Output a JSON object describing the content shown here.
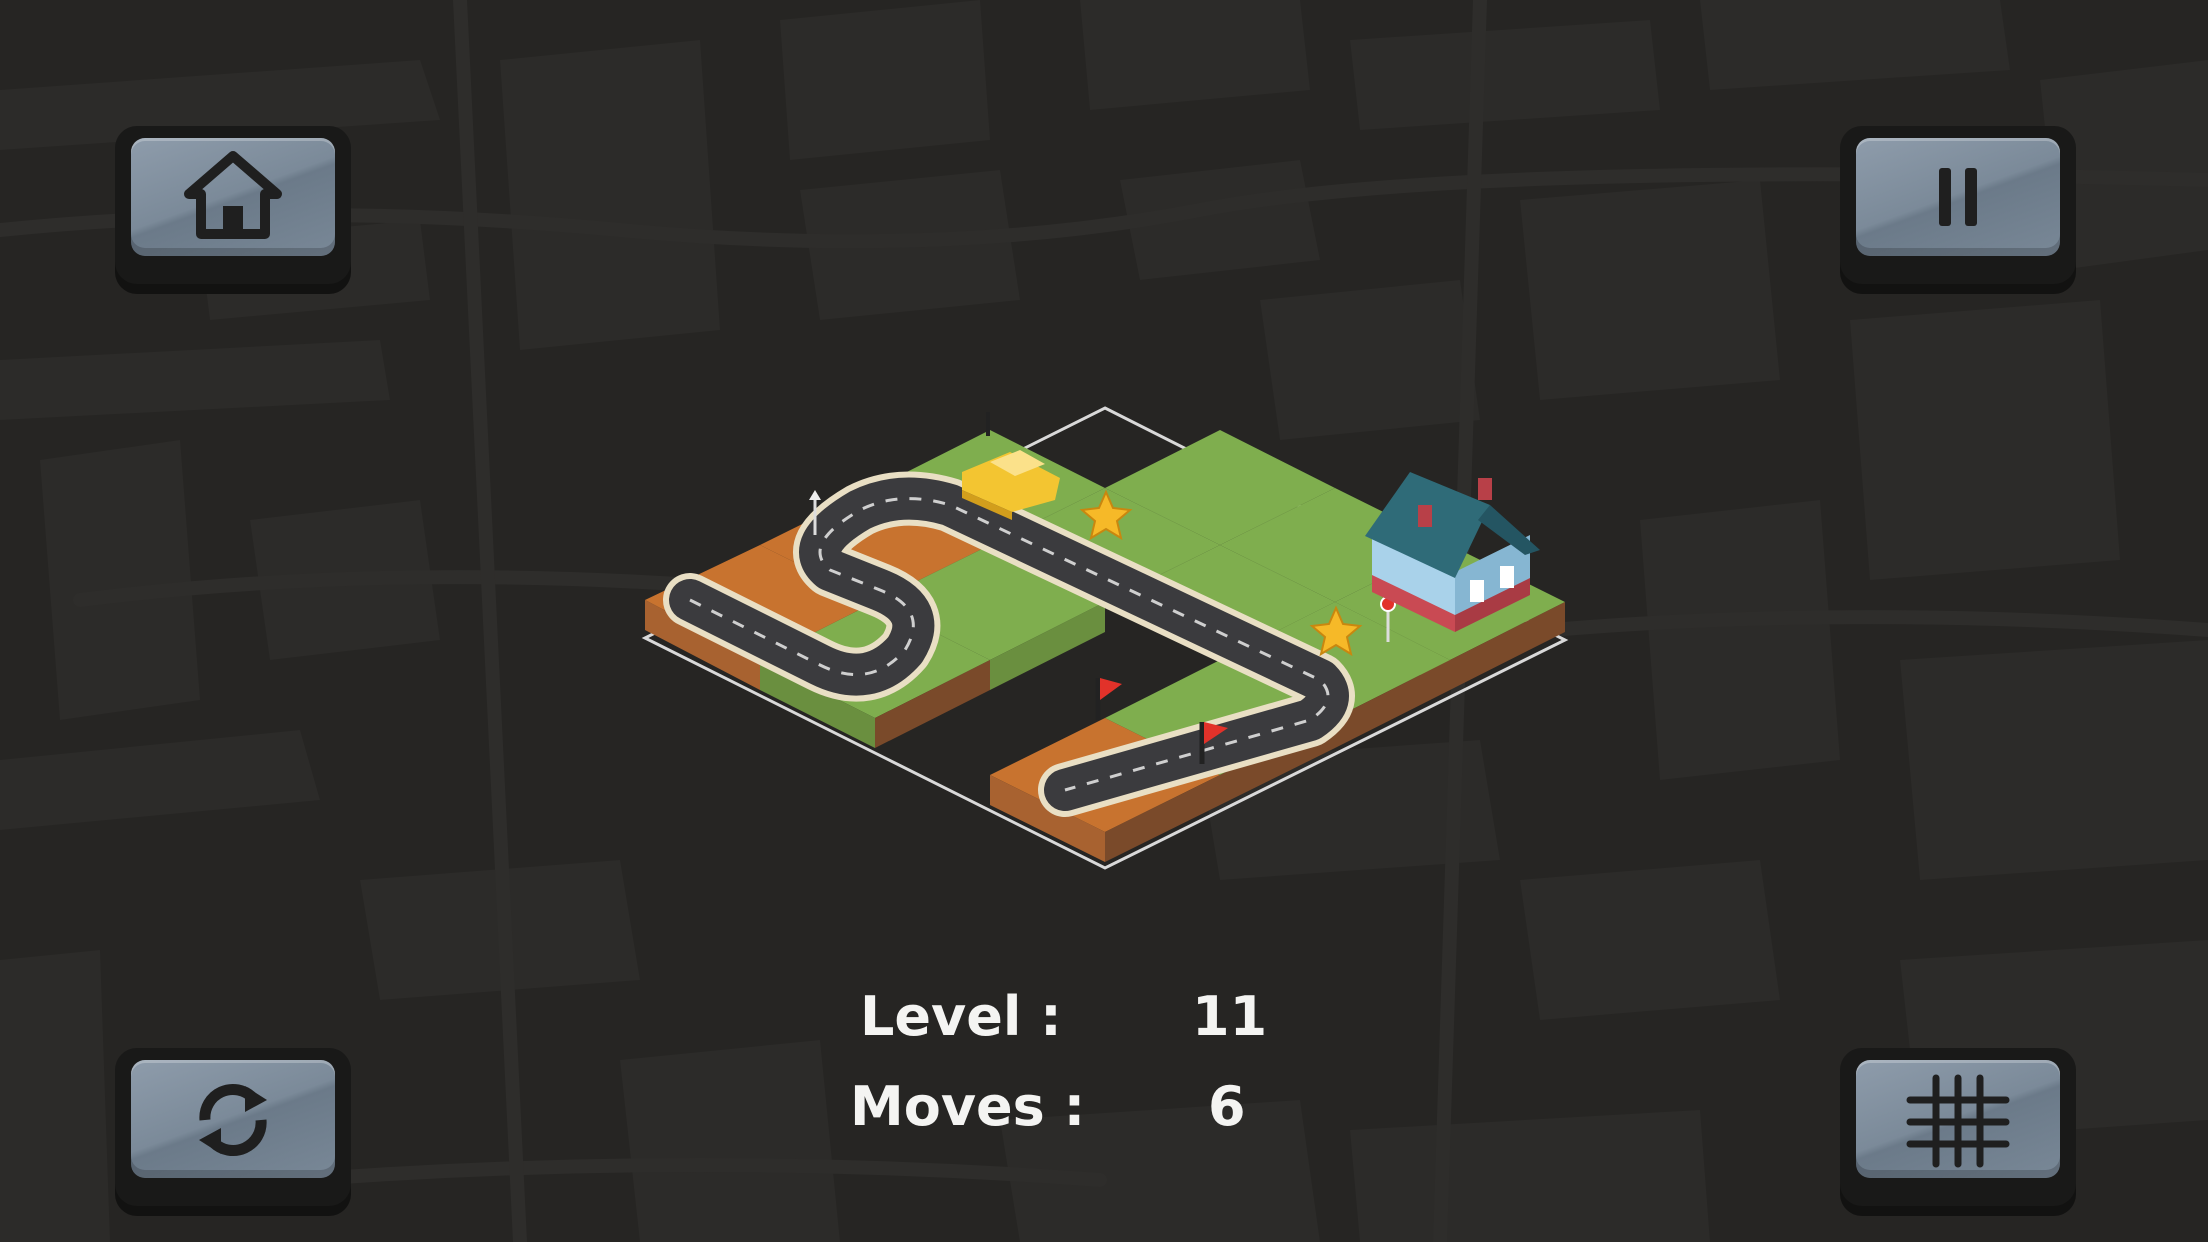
{
  "hud": {
    "home_icon": "home-icon",
    "pause_icon": "pause-icon",
    "restart_icon": "restart-icon",
    "levels_icon": "grid-icon"
  },
  "stats": {
    "level_label": "Level :",
    "level_value": "11",
    "moves_label": "Moves :",
    "moves_value": "6"
  },
  "colors": {
    "background": "#262523",
    "button_face": "#7f8e9d",
    "grass": "#7fae4e",
    "dirt": "#c8732f",
    "road": "#3b3b3e",
    "car": "#f3c531",
    "star": "#f6b928",
    "flag": "#e2322a",
    "house_wall": "#a9d2ea",
    "house_roof": "#2f6b78"
  },
  "board": {
    "car": "yellow-car",
    "stars_collected": 0,
    "stars_total": 2,
    "destination": "house"
  }
}
